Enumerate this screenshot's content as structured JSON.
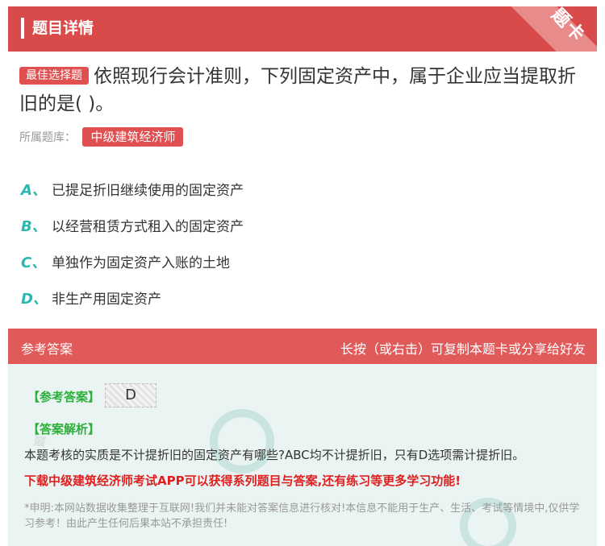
{
  "header": {
    "title": "题目详情",
    "corner_label": "题卡"
  },
  "question": {
    "tag": "最佳选择题",
    "text": "依照现行会计准则，下列固定资产中，属于企业应当提取折旧的是( )。"
  },
  "category": {
    "label": "所属题库：",
    "value": "中级建筑经济师"
  },
  "options": [
    {
      "letter": "A、",
      "text": "已提足折旧继续使用的固定资产"
    },
    {
      "letter": "B、",
      "text": "以经营租赁方式租入的固定资产"
    },
    {
      "letter": "C、",
      "text": "单独作为固定资产入账的土地"
    },
    {
      "letter": "D、",
      "text": "非生产用固定资产"
    }
  ],
  "answer_section": {
    "header_left": "参考答案",
    "header_right": "长按（或右击）可复制本题卡或分享给好友",
    "answer_label": "【参考答案】",
    "answer_value": "D",
    "analysis_label": "【答案解析】",
    "analysis_text": "本题考核的实质是不计提折旧的固定资产有哪些?ABC均不计提折旧，只有D选项需计提折旧。",
    "download_text": "下载中级建筑经济师考试APP可以获得系列题目与答案,还有练习等更多学习功能!",
    "disclaimer": "*申明:本网站数据收集整理于互联网!我们并未能对答案信息进行核对!本信息不能用于生产、生活、考试等情境中,仅供学习参考！由此产生任何后果本站不承担责任!"
  },
  "colors": {
    "primary_red": "#d94b4b",
    "teal": "#2cb8b0",
    "green": "#2cb03c"
  }
}
